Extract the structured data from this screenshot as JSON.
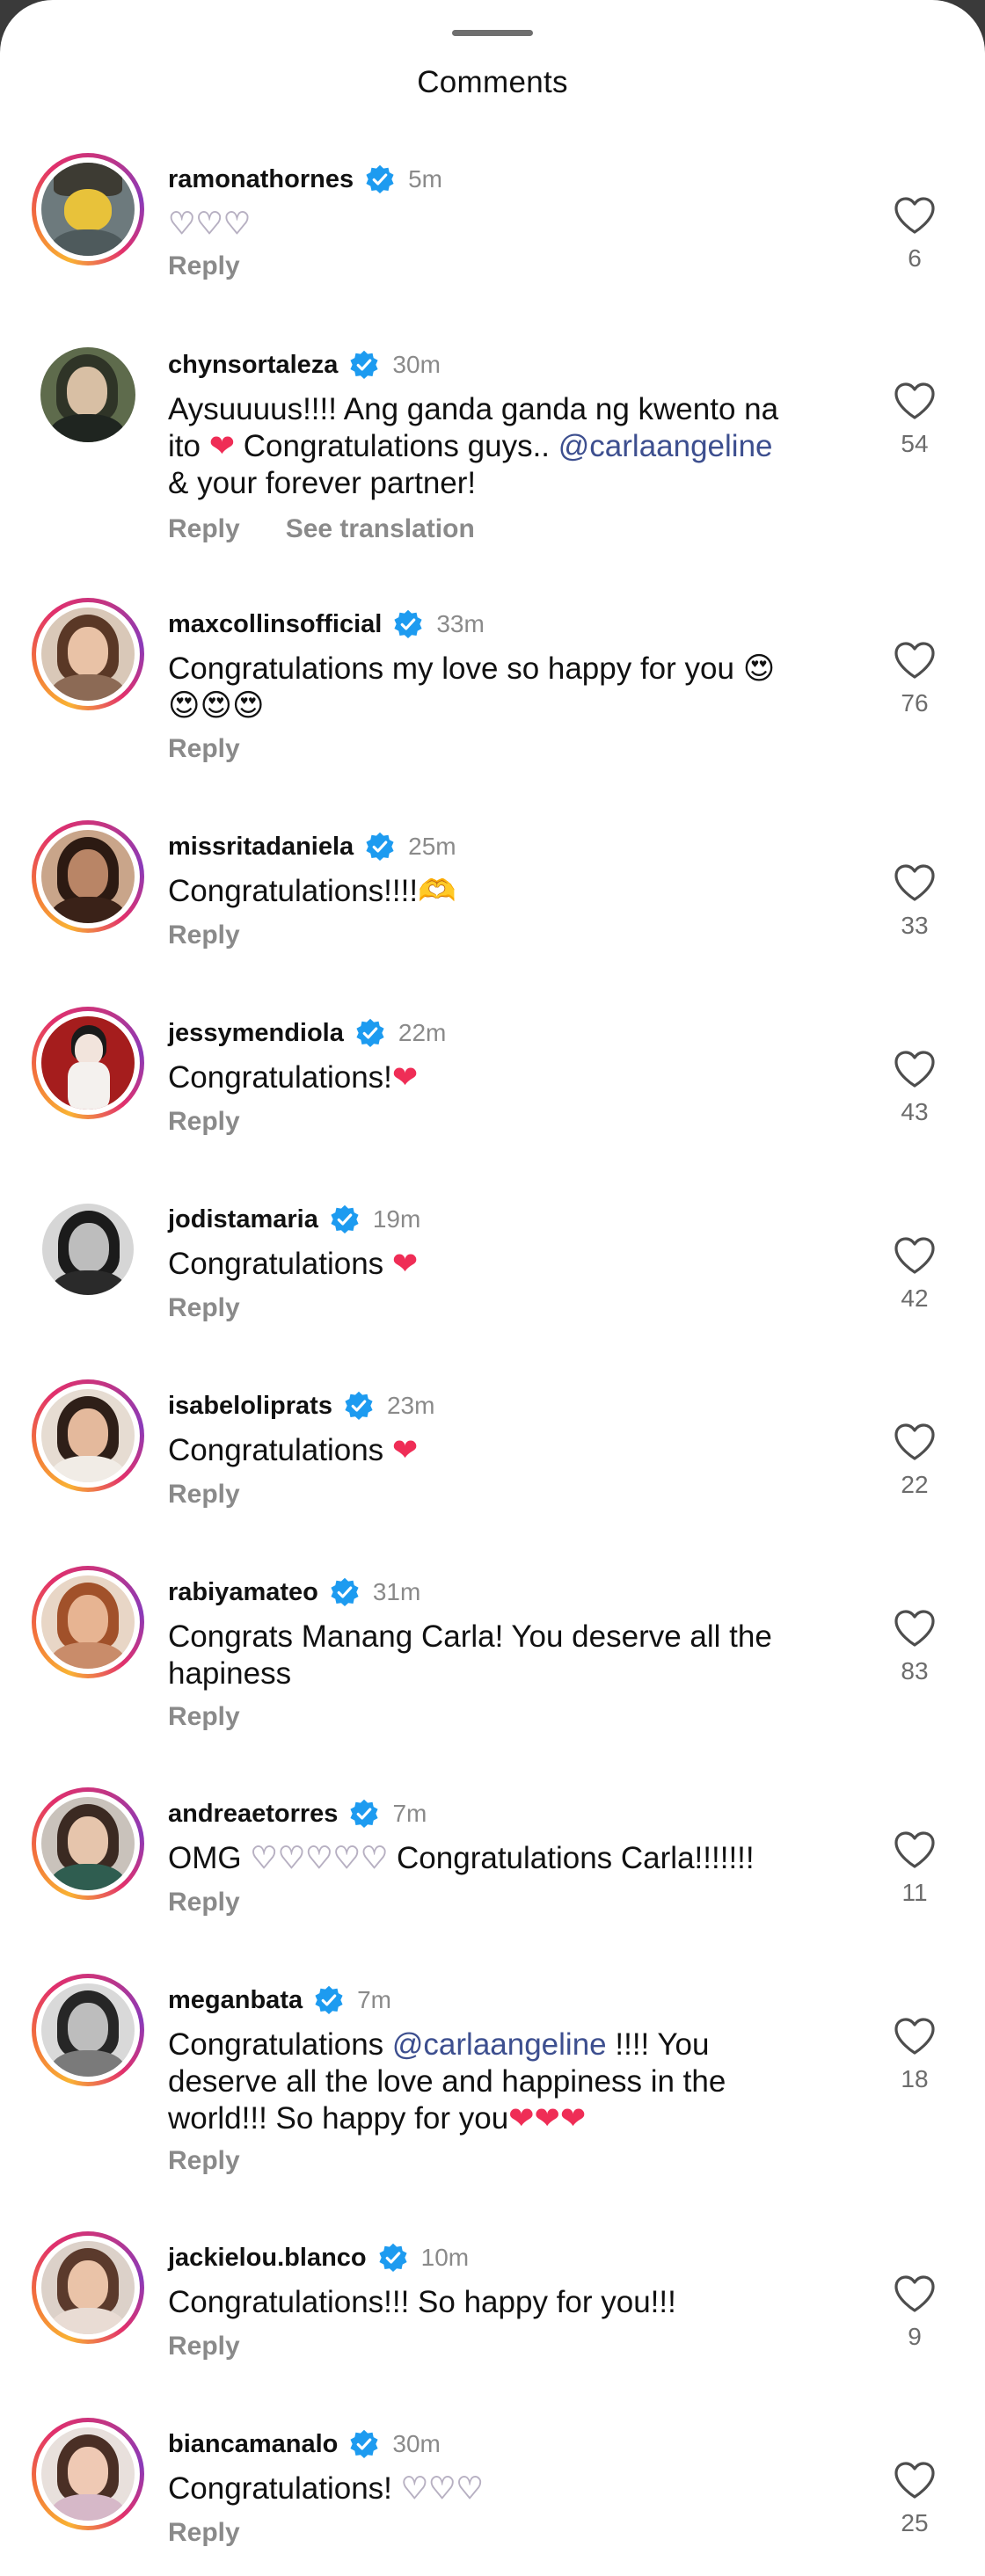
{
  "sheet": {
    "title": "Comments"
  },
  "actions": {
    "reply": "Reply",
    "see_translation": "See translation"
  },
  "comments": [
    {
      "username": "ramonathornes",
      "time": "5m",
      "likes": "6"
    },
    {
      "username": "chynsortaleza",
      "time": "30m",
      "likes": "54"
    },
    {
      "username": "maxcollinsofficial",
      "time": "33m",
      "likes": "76"
    },
    {
      "username": "missritadaniela",
      "time": "25m",
      "likes": "33"
    },
    {
      "username": "jessymendiola",
      "time": "22m",
      "likes": "43"
    },
    {
      "username": "jodistamaria",
      "time": "19m",
      "likes": "42"
    },
    {
      "username": "isabeloliprats",
      "time": "23m",
      "likes": "22"
    },
    {
      "username": "rabiyamateo",
      "time": "31m",
      "likes": "83"
    },
    {
      "username": "andreaetorres",
      "time": "7m",
      "likes": "11"
    },
    {
      "username": "meganbata",
      "time": "7m",
      "likes": "18"
    },
    {
      "username": "jackielou.blanco",
      "time": "10m",
      "likes": "9"
    },
    {
      "username": "biancamanalo",
      "time": "30m",
      "likes": "25"
    }
  ],
  "texts": {
    "c2_line1": "Aysuuuus!!!! Ang ganda ganda ng kwento na",
    "c2_line2a": "ito",
    "c2_line2b": "Congratulations guys..",
    "c2_mention": "@carlaangeline",
    "c2_line3": "& your forever partner!",
    "c3": "Congratulations my love so happy for you",
    "c4": "Congratulations!!!!",
    "c5": "Congratulations!",
    "c6": "Congratulations",
    "c7": "Congratulations",
    "c8_line1": "Congrats Manang Carla! You deserve all the",
    "c8_line2": "hapiness",
    "c9a": "OMG",
    "c9b": "Congratulations Carla!!!!!!!",
    "c10a": "Congratulations",
    "c10_mention": "@carlaangeline",
    "c10b": "!!!! You",
    "c10_line2": "deserve all the love and happiness in the",
    "c10_line3": "world!!! So happy for you",
    "c11": "Congratulations!!! So happy for you!!!",
    "c12": "Congratulations!"
  },
  "emoji": {
    "white_heart": "♡",
    "red_heart": "❤",
    "heart_eyes": "😍",
    "heart_hands": "🫶"
  },
  "icons": {
    "verified": "verified-badge-icon",
    "like": "heart-outline-icon"
  },
  "colors": {
    "verified": "#1d9bf0",
    "mention": "#3d4f8f",
    "muted": "#8a8a8a",
    "red_heart": "#ef2d56"
  }
}
